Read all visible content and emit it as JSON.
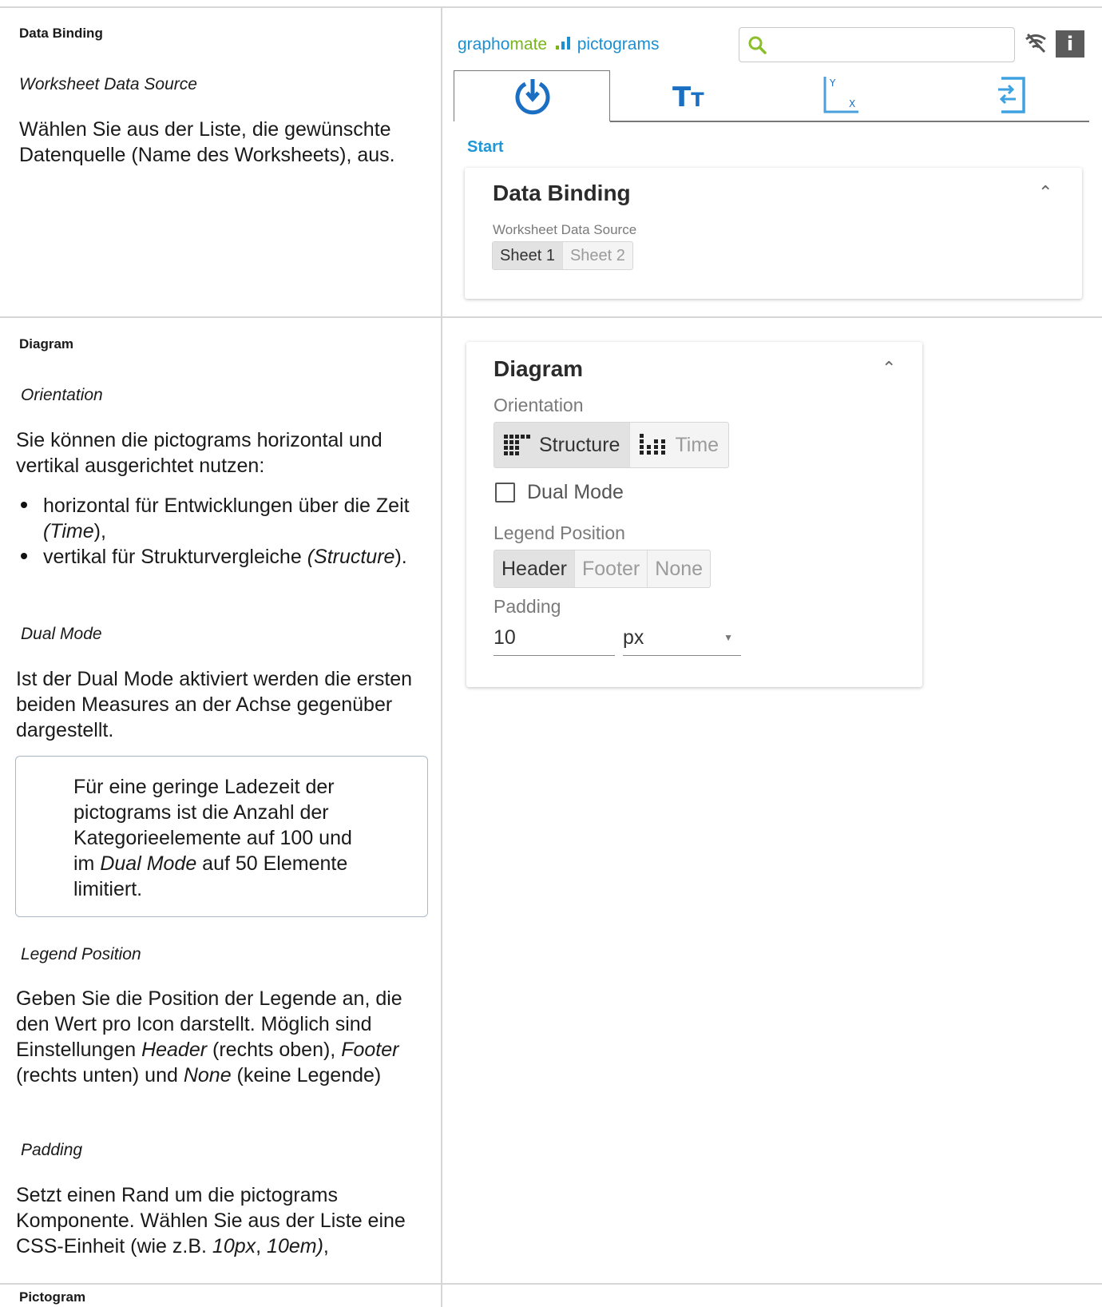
{
  "sections": {
    "data_binding": {
      "title": "Data Binding",
      "subtitle": "Worksheet Data Source",
      "text": "Wählen Sie aus der Liste, die gewünschte Datenquelle (Name des Worksheets), aus."
    },
    "diagram": {
      "title": "Diagram",
      "orientation_label": "Orientation",
      "orientation_text": "Sie können die pictograms horizontal und vertikal ausgerichtet nutzen:",
      "bullet1_a": "horizontal für Entwicklungen über die Zeit ",
      "bullet1_i": "(Time",
      "bullet1_b": "),",
      "bullet2_a": "vertikal für Strukturvergleiche ",
      "bullet2_i": "(Structure",
      "bullet2_b": ").",
      "dual_label": "Dual Mode",
      "dual_text": "Ist der Dual Mode aktiviert werden die ersten beiden Measures an der Achse gegenüber dargestellt.",
      "note_a": "Für eine geringe Ladezeit der pictograms ist die Anzahl der Kategorieelemente auf 100 und im ",
      "note_i": "Dual Mode",
      "note_b": " auf 50 Elemente limitiert.",
      "legend_label": "Legend Position",
      "legend_text_a": "Geben Sie die Position der Legende an, die den Wert pro Icon darstellt. Möglich sind Einstellungen ",
      "legend_i1": "Header",
      "legend_text_b": " (rechts oben), ",
      "legend_i2": "Footer",
      "legend_text_c": " (rechts unten) und ",
      "legend_i3": "None",
      "legend_text_d": " (keine Legende)",
      "padding_label": "Padding",
      "padding_text_a": "Setzt einen Rand um die pictograms Komponente. Wählen Sie aus der Liste eine CSS-Einheit (wie z.B. ",
      "padding_i1": "10px",
      "padding_sep": ", ",
      "padding_i2": "10em)",
      "padding_text_b": ","
    },
    "pictogram": {
      "title": "Pictogram"
    }
  },
  "app": {
    "brand_a": "grapho",
    "brand_b": "mate",
    "brand_c": " pictograms",
    "search_placeholder": "",
    "info_label": "i",
    "start_label": "Start",
    "colors": {
      "brand_blue": "#1d8fd0",
      "brand_green": "#7ab51d",
      "accent": "#2196d6",
      "tab_active": "#1a6fc2"
    }
  },
  "data_binding_card": {
    "title": "Data Binding",
    "label": "Worksheet Data Source",
    "options": [
      "Sheet 1",
      "Sheet 2"
    ],
    "selected": "Sheet 1"
  },
  "diagram_card": {
    "title": "Diagram",
    "orientation_label": "Orientation",
    "orientation_options": [
      "Structure",
      "Time"
    ],
    "orientation_selected": "Structure",
    "dual_mode_label": "Dual Mode",
    "dual_mode_checked": false,
    "legend_label": "Legend Position",
    "legend_options": [
      "Header",
      "Footer",
      "None"
    ],
    "legend_selected": "Header",
    "padding_label": "Padding",
    "padding_value": "10",
    "padding_unit": "px"
  }
}
